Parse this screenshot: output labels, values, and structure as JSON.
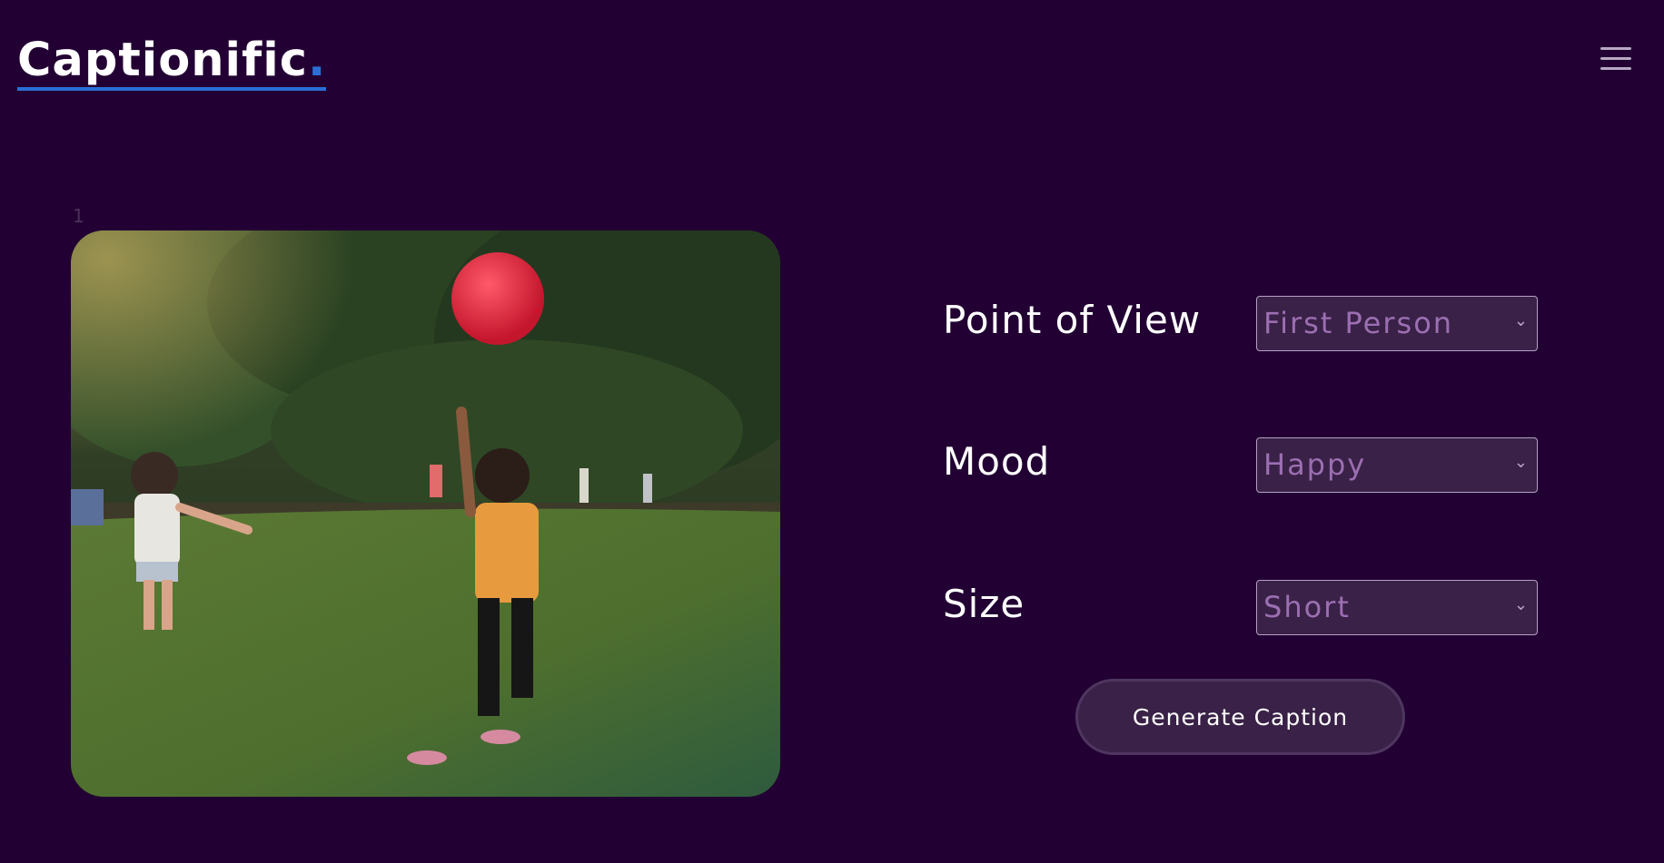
{
  "header": {
    "logo_text": "Captionific",
    "logo_dot": ".",
    "menu_icon": "hamburger-menu-icon"
  },
  "slider": {
    "index": "1",
    "image_description_icon": "photo"
  },
  "form": {
    "point_of_view": {
      "label": "Point of View",
      "value": "First Person"
    },
    "mood": {
      "label": "Mood",
      "value": "Happy"
    },
    "size": {
      "label": "Size",
      "value": "Short"
    },
    "generate_label": "Generate Caption"
  },
  "colors": {
    "background": "#220033",
    "accent": "#2b6fd6",
    "select_bg": "#3a2147",
    "select_text": "#9b6fb2"
  }
}
